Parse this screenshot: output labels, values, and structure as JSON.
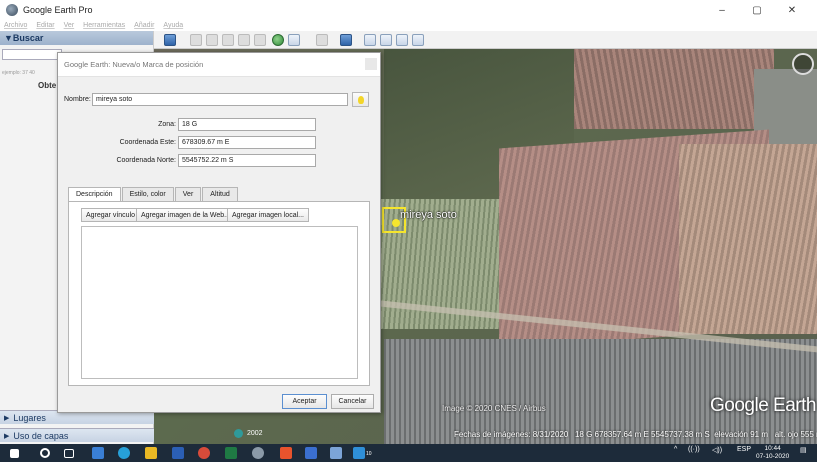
{
  "window": {
    "title": "Google Earth Pro",
    "controls": {
      "minimize": "–",
      "maximize": "▢",
      "close": "✕"
    }
  },
  "menu": {
    "items": [
      "Archivo",
      "Editar",
      "Ver",
      "Herramientas",
      "Añadir",
      "Ayuda"
    ]
  },
  "sidebar": {
    "search_header": "▼Buscar",
    "search_value": "",
    "search_hint": "ejemplo: 37 40",
    "search_button": "Obte",
    "places_label": "Lugares",
    "layers_label": "Uso de capas",
    "collapsed_arrow": "▶"
  },
  "toolbar": {
    "icons": [
      "sidebar-toggle-icon",
      "placemark-icon",
      "polygon-icon",
      "path-icon",
      "overlay-icon",
      "tour-icon",
      "history-icon",
      "sun-icon",
      "planets-icon",
      "ruler-icon",
      "email-icon",
      "print-icon",
      "save-image-icon",
      "maps-icon"
    ]
  },
  "map": {
    "placemark_label": "mireya soto",
    "imagery_credit": "Image © 2020 CNES / Airbus",
    "logo": "Google Earth",
    "history_year": "2002",
    "status": {
      "imagery_date": "Fechas de imágenes: 8/31/2020",
      "coordinates": "18 G 678357.64 m E 5545737.38 m S",
      "elevation": "elevación   91 m",
      "eye_alt": "alt. ojo   555 m"
    }
  },
  "dialog": {
    "title": "Google Earth: Nueva/o Marca de posición",
    "name_label": "Nombre:",
    "name_value": "mireya soto",
    "zone_label": "Zona:",
    "zone_value": "18 G",
    "east_label": "Coordenada Este:",
    "east_value": "678309.67 m E",
    "north_label": "Coordenada Norte:",
    "north_value": "5545752.22 m S",
    "tabs": [
      "Descripción",
      "Estilo, color",
      "Ver",
      "Altitud"
    ],
    "active_tab": "Descripción",
    "add_link": "Agregar vínculo",
    "add_web_image": "Agregar imagen de la Web...",
    "add_local_image": "Agregar imagen local...",
    "description_value": "",
    "ok": "Aceptar",
    "cancel": "Cancelar"
  },
  "taskbar": {
    "badge_count": "10",
    "tray": {
      "chevron": "^",
      "wifi": "((·))",
      "volume": "◁))",
      "language": "ESP",
      "notification": "▤"
    },
    "time": "10:44",
    "date": "07-10-2020"
  },
  "colors": {
    "placemark_yellow": "#f5e52d",
    "sidebar_header": "#9db2cc",
    "taskbar_bg": "#1d2b3a"
  }
}
